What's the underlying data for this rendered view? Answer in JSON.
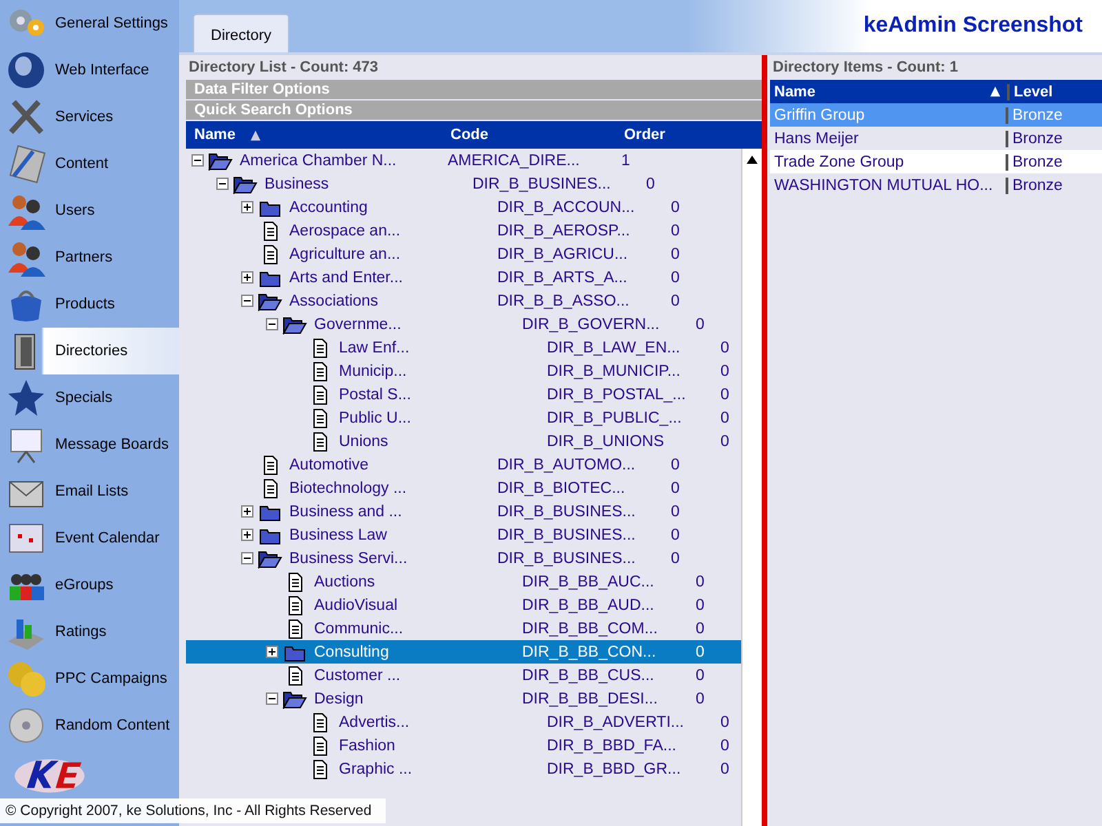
{
  "sidebar": {
    "items": [
      {
        "label": "General Settings",
        "selected": false
      },
      {
        "label": "Web Interface",
        "selected": false
      },
      {
        "label": "Services",
        "selected": false
      },
      {
        "label": "Content",
        "selected": false
      },
      {
        "label": "Users",
        "selected": false
      },
      {
        "label": "Partners",
        "selected": false
      },
      {
        "label": "Products",
        "selected": false
      },
      {
        "label": "Directories",
        "selected": true
      },
      {
        "label": "Specials",
        "selected": false
      },
      {
        "label": "Message Boards",
        "selected": false
      },
      {
        "label": "Email Lists",
        "selected": false
      },
      {
        "label": "Event Calendar",
        "selected": false
      },
      {
        "label": "eGroups",
        "selected": false
      },
      {
        "label": "Ratings",
        "selected": false
      },
      {
        "label": "PPC Campaigns",
        "selected": false
      },
      {
        "label": "Random Content",
        "selected": false
      }
    ]
  },
  "copyright": "© Copyright 2007, ke Solutions, Inc - All Rights Reserved",
  "tabs": [
    {
      "label": "Directory",
      "selected": true
    }
  ],
  "app_title": "keAdmin Screenshot",
  "directory_list": {
    "title": "Directory List - Count: 473",
    "sections": [
      "Data Filter Options",
      "Quick Search Options"
    ],
    "columns": [
      "Name",
      "Code",
      "Order"
    ],
    "tree": [
      {
        "kind": "folder",
        "name": "America Chamber N...",
        "code": "AMERICA_DIRE...",
        "order": "1",
        "expanded": true,
        "selected": false,
        "children": [
          {
            "kind": "folder",
            "name": "Business",
            "code": "DIR_B_BUSINES...",
            "order": "0",
            "expanded": true,
            "selected": false,
            "children": [
              {
                "kind": "folder",
                "name": "Accounting",
                "code": "DIR_B_ACCOUN...",
                "order": "0",
                "expanded": false,
                "selected": false
              },
              {
                "kind": "document",
                "name": "Aerospace an...",
                "code": "DIR_B_AEROSP...",
                "order": "0",
                "selected": false
              },
              {
                "kind": "document",
                "name": "Agriculture an...",
                "code": "DIR_B_AGRICU...",
                "order": "0",
                "selected": false
              },
              {
                "kind": "folder",
                "name": "Arts and Enter...",
                "code": "DIR_B_ARTS_A...",
                "order": "0",
                "expanded": false,
                "selected": false
              },
              {
                "kind": "folder",
                "name": "Associations",
                "code": "DIR_B_B_ASSO...",
                "order": "0",
                "expanded": true,
                "selected": false,
                "children": [
                  {
                    "kind": "folder",
                    "name": "Governme...",
                    "code": "DIR_B_GOVERN...",
                    "order": "0",
                    "expanded": true,
                    "selected": false,
                    "children": [
                      {
                        "kind": "document",
                        "name": "Law Enf...",
                        "code": "DIR_B_LAW_EN...",
                        "order": "0",
                        "selected": false
                      },
                      {
                        "kind": "document",
                        "name": "Municip...",
                        "code": "DIR_B_MUNICIP...",
                        "order": "0",
                        "selected": false
                      },
                      {
                        "kind": "document",
                        "name": "Postal S...",
                        "code": "DIR_B_POSTAL_...",
                        "order": "0",
                        "selected": false
                      },
                      {
                        "kind": "document",
                        "name": "Public U...",
                        "code": "DIR_B_PUBLIC_...",
                        "order": "0",
                        "selected": false
                      },
                      {
                        "kind": "document",
                        "name": "Unions",
                        "code": "DIR_B_UNIONS",
                        "order": "0",
                        "selected": false
                      }
                    ]
                  }
                ]
              },
              {
                "kind": "document",
                "name": "Automotive",
                "code": "DIR_B_AUTOMO...",
                "order": "0",
                "selected": false
              },
              {
                "kind": "document",
                "name": "Biotechnology ...",
                "code": "DIR_B_BIOTEC...",
                "order": "0",
                "selected": false
              },
              {
                "kind": "folder",
                "name": "Business and ...",
                "code": "DIR_B_BUSINES...",
                "order": "0",
                "expanded": false,
                "selected": false
              },
              {
                "kind": "folder",
                "name": "Business Law",
                "code": "DIR_B_BUSINES...",
                "order": "0",
                "expanded": false,
                "selected": false
              },
              {
                "kind": "folder",
                "name": "Business Servi...",
                "code": "DIR_B_BUSINES...",
                "order": "0",
                "expanded": true,
                "selected": false,
                "children": [
                  {
                    "kind": "document",
                    "name": "Auctions",
                    "code": "DIR_B_BB_AUC...",
                    "order": "0",
                    "selected": false
                  },
                  {
                    "kind": "document",
                    "name": "AudioVisual",
                    "code": "DIR_B_BB_AUD...",
                    "order": "0",
                    "selected": false
                  },
                  {
                    "kind": "document",
                    "name": "Communic...",
                    "code": "DIR_B_BB_COM...",
                    "order": "0",
                    "selected": false
                  },
                  {
                    "kind": "folder",
                    "name": "Consulting",
                    "code": "DIR_B_BB_CON...",
                    "order": "0",
                    "expanded": false,
                    "selected": true
                  },
                  {
                    "kind": "document",
                    "name": "Customer ...",
                    "code": "DIR_B_BB_CUS...",
                    "order": "0",
                    "selected": false
                  },
                  {
                    "kind": "folder",
                    "name": "Design",
                    "code": "DIR_B_BB_DESI...",
                    "order": "0",
                    "expanded": true,
                    "selected": false,
                    "children": [
                      {
                        "kind": "document",
                        "name": "Advertis...",
                        "code": "DIR_B_ADVERTI...",
                        "order": "0",
                        "selected": false
                      },
                      {
                        "kind": "document",
                        "name": "Fashion",
                        "code": "DIR_B_BBD_FA...",
                        "order": "0",
                        "selected": false
                      },
                      {
                        "kind": "document",
                        "name": "Graphic ...",
                        "code": "DIR_B_BBD_GR...",
                        "order": "0",
                        "selected": false
                      }
                    ]
                  }
                ]
              }
            ]
          }
        ]
      }
    ]
  },
  "directory_items": {
    "title": "Directory Items - Count: 1",
    "columns": [
      "Name",
      "Level"
    ],
    "rows": [
      {
        "name": "Griffin Group",
        "level": "Bronze",
        "selected": true
      },
      {
        "name": "Hans Meijer",
        "level": "Bronze",
        "selected": false
      },
      {
        "name": "Trade Zone Group",
        "level": "Bronze",
        "selected": false
      },
      {
        "name": "WASHINGTON MUTUAL HO...",
        "level": "Bronze",
        "selected": false
      }
    ]
  }
}
